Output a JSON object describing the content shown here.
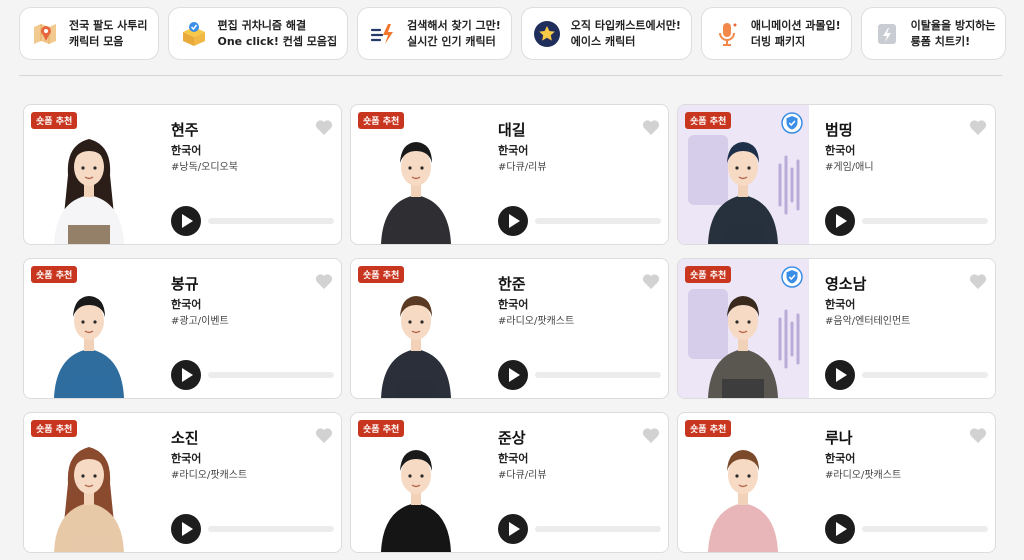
{
  "categories": [
    {
      "line1": "전국 팔도 사투리",
      "line2": "캐릭터 모음",
      "icon": "map-pin-icon"
    },
    {
      "line1": "편집 귀차니즘 해결",
      "line2": "One click! 컨셉 모음집",
      "icon": "gift-box-icon"
    },
    {
      "line1": "검색해서 찾기 그만!",
      "line2": "실시간 인기 캐릭터",
      "icon": "lightning-list-icon"
    },
    {
      "line1": "오직 타입캐스트에서만!",
      "line2": "에이스 캐릭터",
      "icon": "star-icon"
    },
    {
      "line1": "애니메이션 과몰입!",
      "line2": "더빙 패키지",
      "icon": "microphone-icon"
    },
    {
      "line1": "이탈율을 방지하는",
      "line2": "룡폼 치트키!",
      "icon": "bolt-card-icon"
    }
  ],
  "badge_label": "숏폼 추천",
  "characters": [
    {
      "name": "현주",
      "lang": "한국어",
      "tag": "#낭독/오디오북",
      "verified": false,
      "hair": "#2b1d17",
      "outfit": "#f5f5f7",
      "bottom": "#8a7359",
      "long_hair": true
    },
    {
      "name": "대길",
      "lang": "한국어",
      "tag": "#다큐/리뷰",
      "verified": false,
      "hair": "#1a1a1a",
      "outfit": "#2f2f33",
      "bottom": "#2f2f33",
      "long_hair": false
    },
    {
      "name": "범띵",
      "lang": "한국어",
      "tag": "#게임/애니",
      "verified": true,
      "hair": "#1e2f4a",
      "outfit": "#27313d",
      "bottom": "#27313d",
      "long_hair": false
    },
    {
      "name": "봉규",
      "lang": "한국어",
      "tag": "#광고/이벤트",
      "verified": false,
      "hair": "#1a1a1a",
      "outfit": "#2f6d9e",
      "bottom": "#2f6d9e",
      "long_hair": false
    },
    {
      "name": "한준",
      "lang": "한국어",
      "tag": "#라디오/팟캐스트",
      "verified": false,
      "hair": "#5a3a22",
      "outfit": "#2a2f3a",
      "bottom": "#2a2f3a",
      "long_hair": false
    },
    {
      "name": "영소남",
      "lang": "한국어",
      "tag": "#음악/엔터테인먼트",
      "verified": true,
      "hair": "#3a2a1e",
      "outfit": "#5a5650",
      "bottom": "#3b3b3b",
      "long_hair": false
    },
    {
      "name": "소진",
      "lang": "한국어",
      "tag": "#라디오/팟캐스트",
      "verified": false,
      "hair": "#8a4a2e",
      "outfit": "#e7c9a8",
      "bottom": "#e7c9a8",
      "long_hair": true
    },
    {
      "name": "준상",
      "lang": "한국어",
      "tag": "#다큐/리뷰",
      "verified": false,
      "hair": "#1a1a1a",
      "outfit": "#151515",
      "bottom": "#151515",
      "long_hair": false
    },
    {
      "name": "루나",
      "lang": "한국어",
      "tag": "#라디오/팟캐스트",
      "verified": false,
      "hair": "#7a4a2a",
      "outfit": "#e8b6b8",
      "bottom": "#e8b6b8",
      "long_hair": false
    }
  ]
}
